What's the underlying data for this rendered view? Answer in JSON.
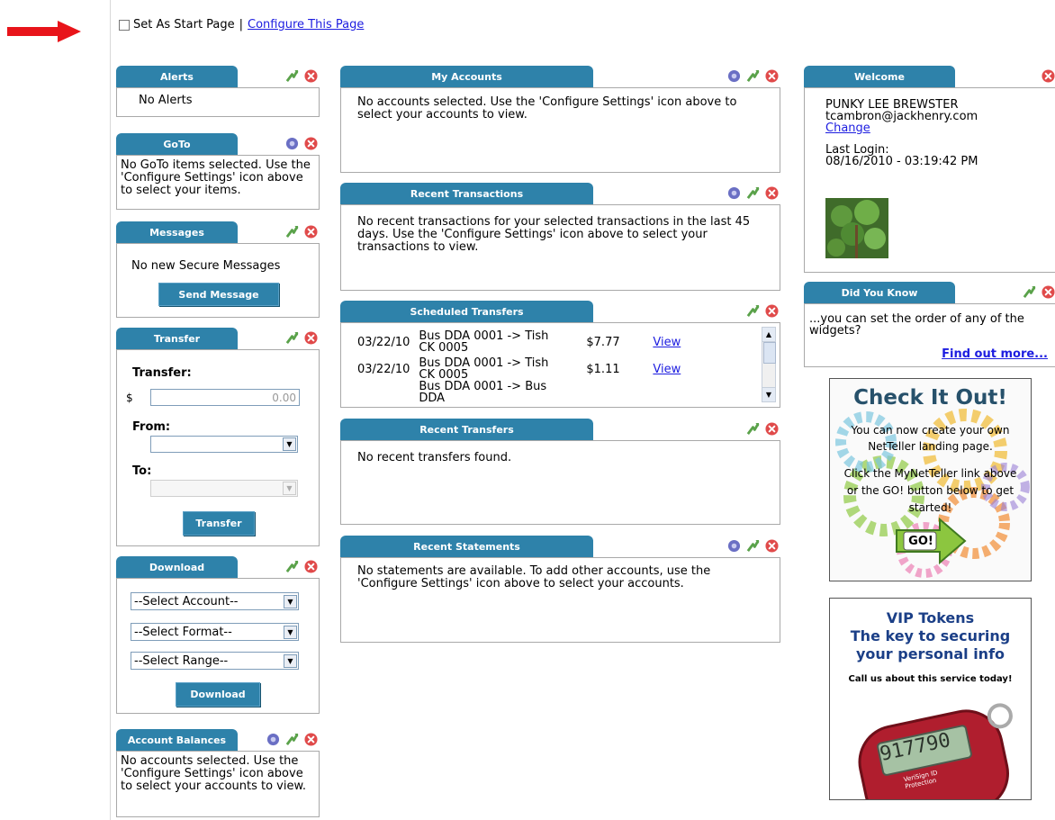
{
  "top": {
    "start_page_label": "Set As Start Page",
    "separator": "|",
    "configure_label": "Configure This Page"
  },
  "alerts": {
    "title": "Alerts",
    "body": "No Alerts"
  },
  "goto": {
    "title": "GoTo",
    "body": "No GoTo items selected. Use the 'Configure Settings' icon above to select your items."
  },
  "messages": {
    "title": "Messages",
    "body": "No new Secure Messages",
    "button": "Send Message"
  },
  "transfer": {
    "title": "Transfer",
    "transfer_label": "Transfer:",
    "currency": "$",
    "amount_placeholder": "0.00",
    "from_label": "From:",
    "to_label": "To:",
    "button": "Transfer"
  },
  "download": {
    "title": "Download",
    "account_select": "--Select Account--",
    "format_select": "--Select Format--",
    "range_select": "--Select Range--",
    "button": "Download"
  },
  "account_balances": {
    "title": "Account Balances",
    "body": "No accounts selected. Use the 'Configure Settings' icon above to select your accounts to view."
  },
  "my_accounts": {
    "title": "My Accounts",
    "body": "No accounts selected. Use the 'Configure Settings' icon above to select your accounts to view."
  },
  "recent_transactions": {
    "title": "Recent Transactions",
    "body": "No recent transactions for your selected transactions in the last 45 days. Use the 'Configure Settings' icon above to select your transactions to view."
  },
  "scheduled_transfers": {
    "title": "Scheduled Transfers",
    "rows": [
      {
        "date": "03/22/10",
        "desc": "Bus DDA 0001 -> Tish CK 0005",
        "amount": "$7.77",
        "action": "View"
      },
      {
        "date": "03/22/10",
        "desc": "Bus DDA 0001 -> Tish CK 0005",
        "amount": "$1.11",
        "action": "View"
      },
      {
        "date": "",
        "desc": "Bus DDA 0001 -> Bus DDA",
        "amount": "",
        "action": ""
      }
    ]
  },
  "recent_transfers": {
    "title": "Recent Transfers",
    "body": "No recent transfers found."
  },
  "recent_statements": {
    "title": "Recent Statements",
    "body": "No statements are available. To add other accounts, use the 'Configure Settings' icon above to select your accounts."
  },
  "welcome": {
    "title": "Welcome",
    "name": "PUNKY LEE BREWSTER",
    "email": "tcambron@jackhenry.com",
    "change_label": "Change",
    "last_login_label": "Last Login:",
    "last_login_value": "08/16/2010 - 03:19:42 PM"
  },
  "did_you_know": {
    "title": "Did You Know",
    "body": "...you can set the order of any of the widgets?",
    "link": "Find out more..."
  },
  "promo_checkit": {
    "headline": "Check It Out!",
    "line1": "You can now create your own NetTeller landing page.",
    "line2": "Click the MyNetTeller link above or the GO! button below to get started!",
    "go_label": "GO!"
  },
  "promo_vip": {
    "line1": "VIP Tokens",
    "line2": "The key to securing",
    "line3": "your personal info",
    "line4": "Call us about this service today!",
    "token_display": "917790",
    "token_brand": "VeriSign ID Protection"
  },
  "colors": {
    "tab_blue": "#2e82aa",
    "link_blue": "#1d1de0",
    "close_red": "#e04a4a",
    "config_purple": "#6a6fc4",
    "arrow_green": "#5aa24a",
    "alert_red": "#e8141a"
  }
}
